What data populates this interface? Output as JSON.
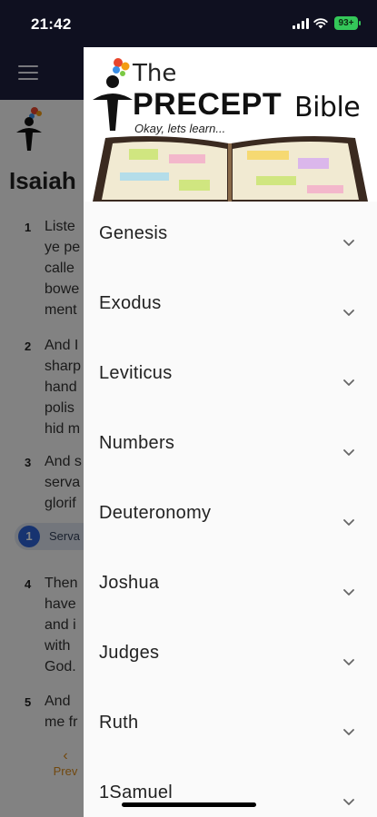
{
  "status_bar": {
    "time": "21:42",
    "battery": "93+"
  },
  "background_page": {
    "title": "Isaiah",
    "verses": [
      {
        "num": "1",
        "lines": [
          "Liste",
          "ye pe",
          "calle",
          "bowe",
          "ment"
        ]
      },
      {
        "num": "2",
        "lines": [
          "And I",
          "sharp",
          "hand",
          "polis",
          "hid m"
        ]
      },
      {
        "num": "3",
        "lines": [
          "And s",
          "serva",
          "glorif"
        ]
      },
      {
        "num": "4",
        "lines": [
          "Then",
          "have",
          "and i",
          "with",
          "God."
        ]
      },
      {
        "num": "5",
        "lines": [
          "And",
          "me fr"
        ]
      }
    ],
    "servant_chip": {
      "num": "1",
      "label": "Serva"
    },
    "prev_label": "Prev"
  },
  "drawer": {
    "brand": {
      "the": "The",
      "precept": "PRECEPT",
      "bible": "Bible",
      "tagline": "Okay, lets learn..."
    },
    "books": [
      "Genesis",
      "Exodus",
      "Leviticus",
      "Numbers",
      "Deuteronomy",
      "Joshua",
      "Judges",
      "Ruth",
      "1Samuel"
    ]
  },
  "colors": {
    "header_bg": "#1d1f3f",
    "accent_prev": "#d88a1c",
    "chip_blue": "#2c63d6",
    "battery_green": "#34c759"
  }
}
